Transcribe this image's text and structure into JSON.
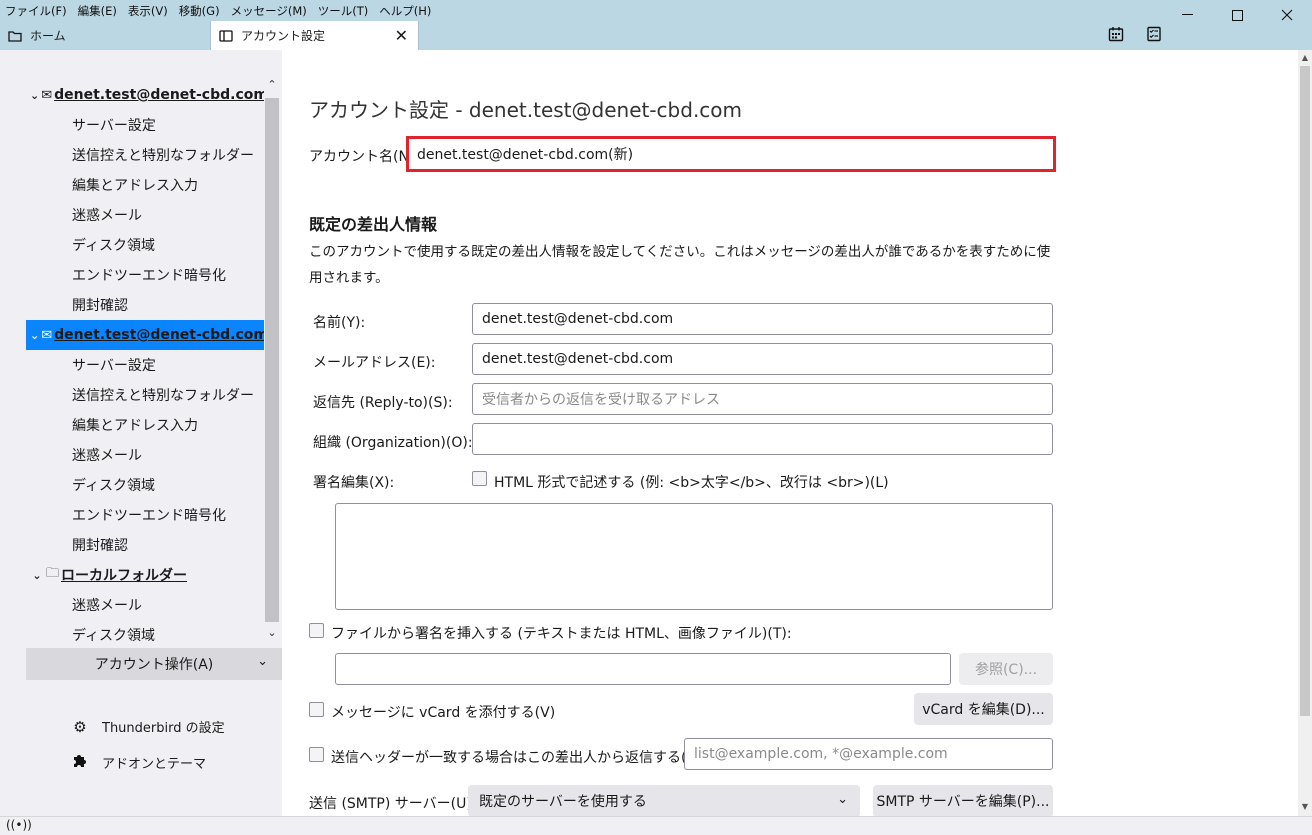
{
  "menu": [
    "ファイル(F)",
    "編集(E)",
    "表示(V)",
    "移動(G)",
    "メッセージ(M)",
    "ツール(T)",
    "ヘルプ(H)"
  ],
  "window_controls": {
    "minimize": "—",
    "maximize": "☐",
    "close": "✕"
  },
  "tabs": {
    "home": "ホーム",
    "active": "アカウント設定",
    "close": "✕"
  },
  "sidebar": {
    "accounts": [
      {
        "name": "denet.test@denet-cbd.com",
        "selected": false,
        "items": [
          "サーバー設定",
          "送信控えと特別なフォルダー",
          "編集とアドレス入力",
          "迷惑メール",
          "ディスク領域",
          "エンドツーエンド暗号化",
          "開封確認"
        ]
      },
      {
        "name": "denet.test@denet-cbd.com (...",
        "selected": true,
        "items": [
          "サーバー設定",
          "送信控えと特別なフォルダー",
          "編集とアドレス入力",
          "迷惑メール",
          "ディスク領域",
          "エンドツーエンド暗号化",
          "開封確認"
        ]
      },
      {
        "name": "ローカルフォルダー",
        "selected": false,
        "items": [
          "迷惑メール",
          "ディスク領域"
        ]
      }
    ],
    "account_actions": "アカウント操作(A)",
    "settings_link": "Thunderbird の設定",
    "addons_link": "アドオンとテーマ"
  },
  "main": {
    "title": "アカウント設定 - denet.test@denet-cbd.com",
    "account_name_label": "アカウント名(N):",
    "account_name_value": "denet.test@denet-cbd.com(新)",
    "identity_section_title": "既定の差出人情報",
    "identity_section_desc": "このアカウントで使用する既定の差出人情報を設定してください。これはメッセージの差出人が誰であるかを表すために使用されます。",
    "name_label": "名前(Y):",
    "name_value": "denet.test@denet-cbd.com",
    "email_label": "メールアドレス(E):",
    "email_value": "denet.test@denet-cbd.com",
    "replyto_label": "返信先 (Reply-to)(S):",
    "replyto_placeholder": "受信者からの返信を受け取るアドレス",
    "org_label": "組織 (Organization)(O):",
    "org_value": "",
    "signature_label": "署名編集(X):",
    "html_checkbox_label": "HTML 形式で記述する (例: <b>太字</b>、改行は <br>)(L)",
    "sigfile_checkbox_label": "ファイルから署名を挿入する (テキストまたは HTML、画像ファイル)(T):",
    "browse_button": "参照(C)...",
    "vcard_checkbox_label": "メッセージに vCard を添付する(V)",
    "vcard_edit_button": "vCard を編集(D)...",
    "reply_header_checkbox_label": "送信ヘッダーが一致する場合はこの差出人から返信する(D):",
    "reply_header_placeholder": "list@example.com, *@example.com",
    "smtp_label": "送信 (SMTP) サーバー(U):",
    "smtp_value": "既定のサーバーを使用する",
    "smtp_edit_button": "SMTP サーバーを編集(P)..."
  },
  "colors": {
    "accent": "#0a84ff",
    "highlight_border": "#e0242e",
    "chrome": "#bcd7e4",
    "sidebar": "#f0f0f4"
  }
}
